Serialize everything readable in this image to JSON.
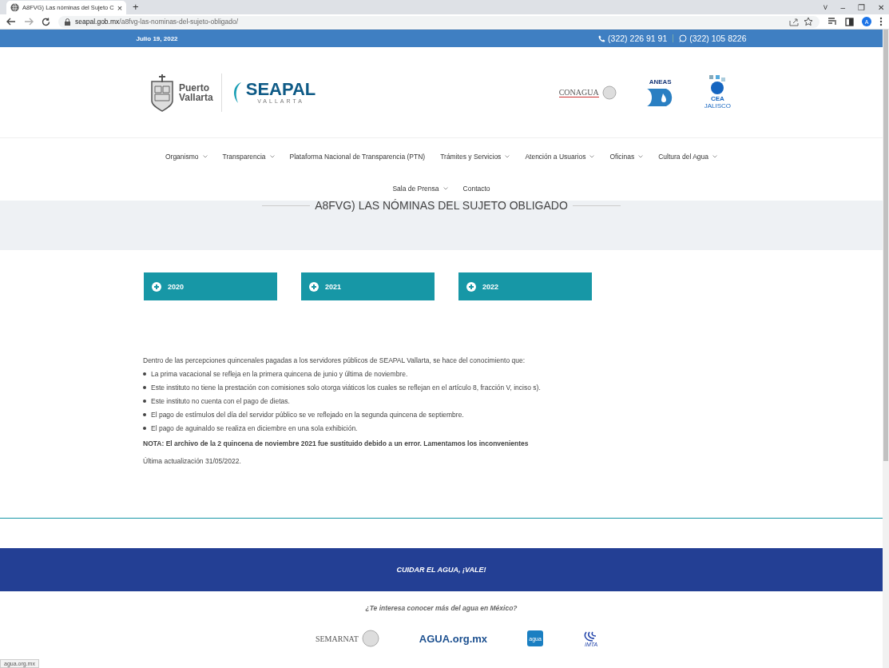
{
  "browser": {
    "tab_title": "A8FVG) Las nóminas del Sujeto C",
    "tab_close": "×",
    "new_tab": "+",
    "url_host": "seapal.gob.mx",
    "url_path": "/a8fvg-las-nominas-del-sujeto-obligado/",
    "profile_initial": "A",
    "window_controls": [
      "˅",
      "–",
      "❐",
      "✕"
    ]
  },
  "topbar": {
    "date": "Julio 19, 2022",
    "phone": "(322) 226 91 91",
    "whatsapp": "(322) 105 8226"
  },
  "header": {
    "logos": [
      {
        "kind": "pv",
        "lines": [
          "Puerto",
          "Vallarta"
        ]
      },
      {
        "kind": "seapal",
        "lines": [
          "SEAPAL",
          "VALLARTA"
        ]
      },
      {
        "kind": "conagua",
        "lines": [
          "CONAGUA"
        ]
      },
      {
        "kind": "aneas",
        "lines": [
          "ANEAS"
        ]
      },
      {
        "kind": "cea",
        "lines": [
          "CEA",
          "JALISCO"
        ]
      }
    ]
  },
  "nav": {
    "rows": [
      {
        "items": [
          {
            "label": "Organismo",
            "dropdown": true
          },
          {
            "label": "Transparencia",
            "dropdown": true
          },
          {
            "label": "Plataforma Nacional de Transparencia (PTN)",
            "dropdown": false
          },
          {
            "label": "Trámites y Servicios",
            "dropdown": true
          },
          {
            "label": "Atención a Usuarios",
            "dropdown": true
          },
          {
            "label": "Oficinas",
            "dropdown": true
          },
          {
            "label": "Cultura del Agua",
            "dropdown": true
          }
        ]
      },
      {
        "items": [
          {
            "label": "Sala de Prensa",
            "dropdown": true
          },
          {
            "label": "Contacto",
            "dropdown": false
          }
        ]
      }
    ]
  },
  "page_title": "A8FVG) LAS NÓMINAS DEL SUJETO OBLIGADO",
  "accordions": [
    {
      "label": "2020",
      "expanded": false
    },
    {
      "label": "2021",
      "expanded": false
    },
    {
      "label": "2022",
      "expanded": false
    }
  ],
  "content": {
    "intro": "Dentro de las percepciones quincenales pagadas a los servidores públicos de SEAPAL Vallarta, se hace del conocimiento que:",
    "bullets": [
      "La prima vacacional se refleja en la primera quincena de junio y última de noviembre.",
      "Este instituto no tiene la prestación con comisiones solo otorga viáticos los cuales se reflejan en el artículo 8, fracción V, inciso s).",
      "Este instituto no cuenta con el pago de dietas.",
      "El pago de estímulos del día del servidor público se ve reflejado en la segunda quincena de septiembre.",
      "El pago de aguinaldo se realiza en diciembre en una sola exhibición."
    ],
    "note": "NOTA: El archivo de la 2 quincena de noviembre 2021 fue sustituido debido a un error. Lamentamos los inconvenientes",
    "updated": "Última actualización 31/05/2022."
  },
  "footer": {
    "banner": "CUIDAR EL AGUA, ¡VALE!",
    "question": "¿Te interesa conocer más del agua en México?",
    "logos": [
      {
        "kind": "semarnat",
        "text": "SEMARNAT"
      },
      {
        "kind": "aguaorg",
        "text": "AGUA.org.mx"
      },
      {
        "kind": "agua",
        "text": "agua"
      },
      {
        "kind": "imta",
        "text": "IMTA"
      }
    ]
  },
  "status_url": "agua.org.mx"
}
